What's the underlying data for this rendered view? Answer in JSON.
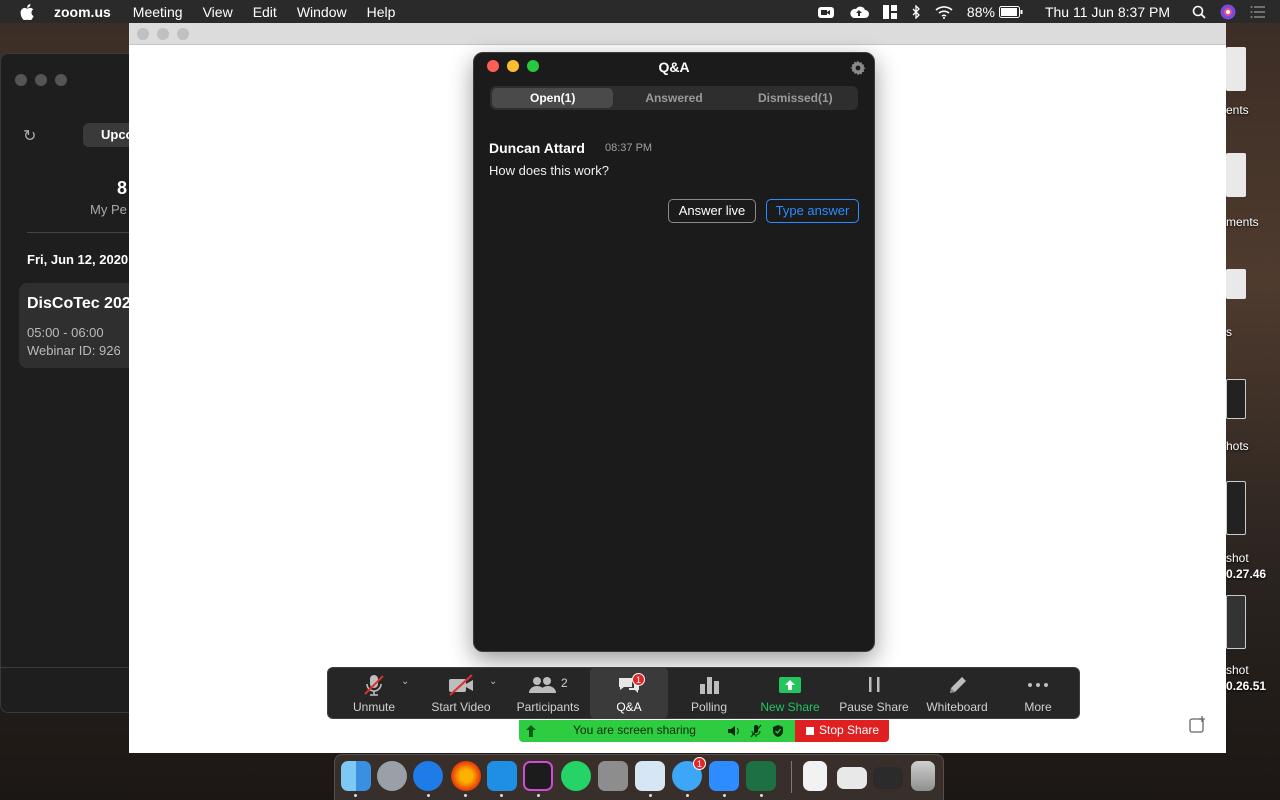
{
  "menubar": {
    "app_name": "zoom.us",
    "items": [
      "Meeting",
      "View",
      "Edit",
      "Window",
      "Help"
    ],
    "battery": "88%",
    "clock": "Thu 11 Jun  8:37 PM"
  },
  "desktop": {
    "labels": [
      "ents",
      "ments",
      "s",
      "hots",
      "shot",
      "0.27.46",
      "shot",
      "0.26.51"
    ]
  },
  "bg_window": {
    "tab_label": "Upco",
    "count": "8",
    "count_label": "My Pe",
    "date_header": "Fri, Jun 12, 2020",
    "card_title": "DisCoTec 202",
    "card_time": "05:00 - 06:00",
    "card_id": "Webinar ID: 926"
  },
  "qa": {
    "title": "Q&A",
    "tabs": [
      {
        "label": "Open(1)",
        "active": true
      },
      {
        "label": "Answered",
        "active": false
      },
      {
        "label": "Dismissed(1)",
        "active": false
      }
    ],
    "question": {
      "asker": "Duncan Attard",
      "time": "08:37 PM",
      "text": "How does this work?"
    },
    "answer_live_label": "Answer live",
    "type_answer_label": "Type answer"
  },
  "toolbar": {
    "unmute": "Unmute",
    "start_video": "Start Video",
    "participants": "Participants",
    "participants_count": "2",
    "qa": "Q&A",
    "qa_badge": "1",
    "polling": "Polling",
    "new_share": "New Share",
    "pause_share": "Pause Share",
    "whiteboard": "Whiteboard",
    "more": "More"
  },
  "sharebar": {
    "text": "You are screen sharing",
    "stop_label": "Stop Share"
  },
  "dock": {
    "messages_badge": "1"
  },
  "colors": {
    "accent_blue": "#2d8cff",
    "share_green": "#2ecc40",
    "stop_red": "#e02020"
  }
}
